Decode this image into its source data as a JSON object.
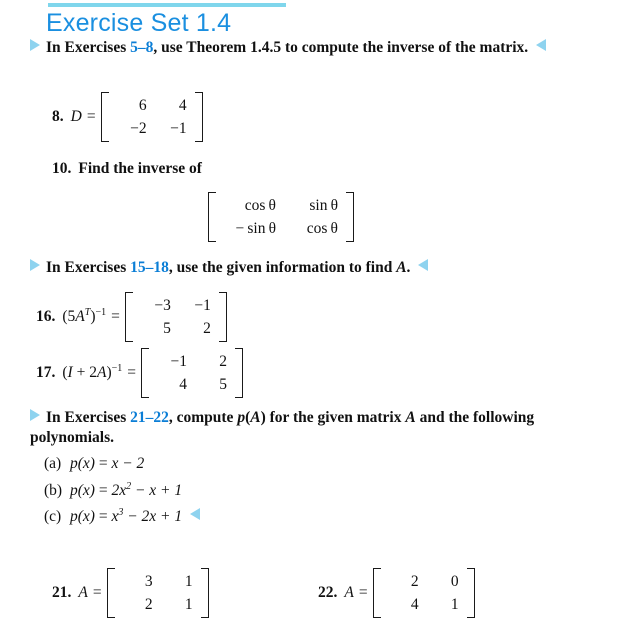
{
  "header": {
    "title": "Exercise Set 1.4",
    "rule_color": "#7fd6ec",
    "title_color": "#1a8fe0"
  },
  "marker_color": "#8ed3ef",
  "range_color": "#0b7ed6",
  "instructions": [
    {
      "id": "instr-5-8",
      "lead": "In Exercises ",
      "range": "5–8",
      "rest": ", use Theorem 1.4.5 to compute the inverse of the matrix."
    },
    {
      "id": "instr-15-18",
      "lead": "In Exercises ",
      "range": "15–18",
      "rest": ", use the given information to find ",
      "italic_tail": "A",
      "period": "."
    },
    {
      "id": "instr-21-22",
      "lead": "In Exercises ",
      "range": "21–22",
      "rest": ", compute ",
      "italic_mid": "p",
      "rest2": "(",
      "italic_mid2": "A",
      "rest3": ") for the given matrix ",
      "italic_tail": "A",
      "rest4": " and the following polynomials."
    }
  ],
  "problems": {
    "p8": {
      "number": "8.",
      "lhs": "D",
      "equals": "=",
      "matrix": [
        [
          "6",
          "4"
        ],
        [
          "−2",
          "−1"
        ]
      ]
    },
    "p10": {
      "number": "10.",
      "text": "Find the inverse of",
      "matrix": [
        [
          "cos θ",
          "sin θ"
        ],
        [
          "− sin θ",
          "cos θ"
        ]
      ]
    },
    "p16": {
      "number": "16.",
      "lhs_open": "(5",
      "lhs_var": "A",
      "lhs_sup1": "T",
      "lhs_close": ")",
      "lhs_sup2": "−1",
      "equals": "=",
      "matrix": [
        [
          "−3",
          "−1"
        ],
        [
          "5",
          "2"
        ]
      ]
    },
    "p17": {
      "number": "17.",
      "lhs_open": "(",
      "lhs_var1": "I",
      "lhs_mid": " + 2",
      "lhs_var2": "A",
      "lhs_close": ")",
      "lhs_sup": "−1",
      "equals": "=",
      "matrix": [
        [
          "−1",
          "2"
        ],
        [
          "4",
          "5"
        ]
      ]
    },
    "p21": {
      "number": "21.",
      "lhs": "A",
      "equals": "=",
      "matrix": [
        [
          "3",
          "1"
        ],
        [
          "2",
          "1"
        ]
      ]
    },
    "p22": {
      "number": "22.",
      "lhs": "A",
      "equals": "=",
      "matrix": [
        [
          "2",
          "0"
        ],
        [
          "4",
          "1"
        ]
      ]
    }
  },
  "polynomials": [
    {
      "label": "(a)",
      "fn": "p",
      "arg": "(x)",
      "equals": " = ",
      "expr_a": "x",
      "expr_b": " − 2"
    },
    {
      "label": "(b)",
      "fn": "p",
      "arg": "(x)",
      "equals": " = ",
      "expr_a": "2x",
      "sup": "2",
      "expr_b": " − x + 1"
    },
    {
      "label": "(c)",
      "fn": "p",
      "arg": "(x)",
      "equals": " = ",
      "expr_a": "x",
      "sup": "3",
      "expr_b": " − 2x + 1"
    }
  ]
}
